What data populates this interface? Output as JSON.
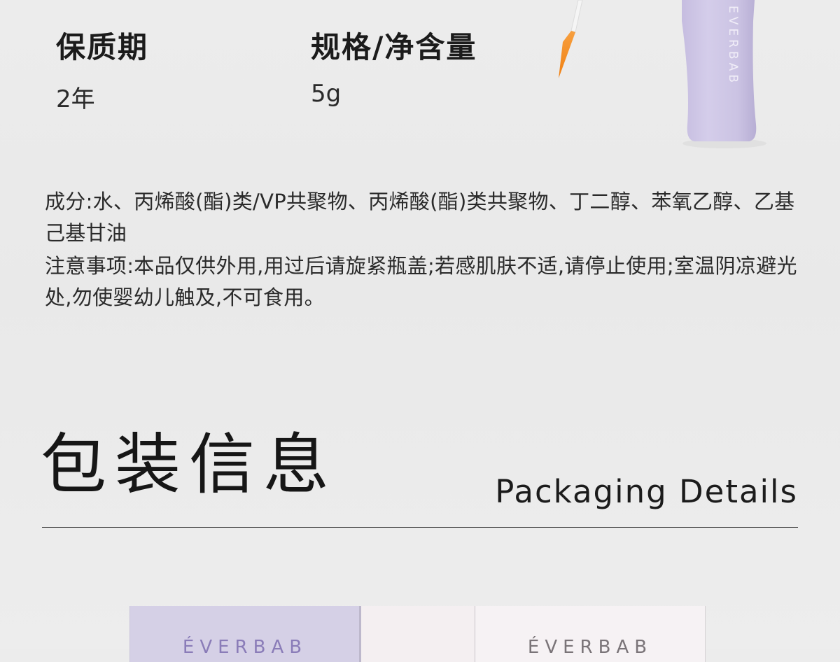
{
  "specs": {
    "shelf_life_label": "保质期",
    "shelf_life_value": "2年",
    "size_label": "规格/净含量",
    "size_value": "5g"
  },
  "ingredients_text": "成分:水、丙烯酸(酯)类/VP共聚物、丙烯酸(酯)类共聚物、丁二醇、苯氧乙醇、乙基己基甘油",
  "notice_text": "注意事项:本品仅供外用,用过后请旋紧瓶盖;若感肌肤不适,请停止使用;室温阴凉避光处,勿使婴幼儿触及,不可食用。",
  "packaging": {
    "title": "包装信息",
    "subtitle": "Packaging Details"
  },
  "brand": {
    "bottle_text": "EVERBAB",
    "box_text_1": "ÉVERBAB",
    "box_text_2": "ÉVERBAB"
  },
  "colors": {
    "bottle": "#cbc3e3",
    "brush_tip": "#f28a1e",
    "box_purple": "#d5d0e6",
    "box_pink": "#f4eff1"
  }
}
